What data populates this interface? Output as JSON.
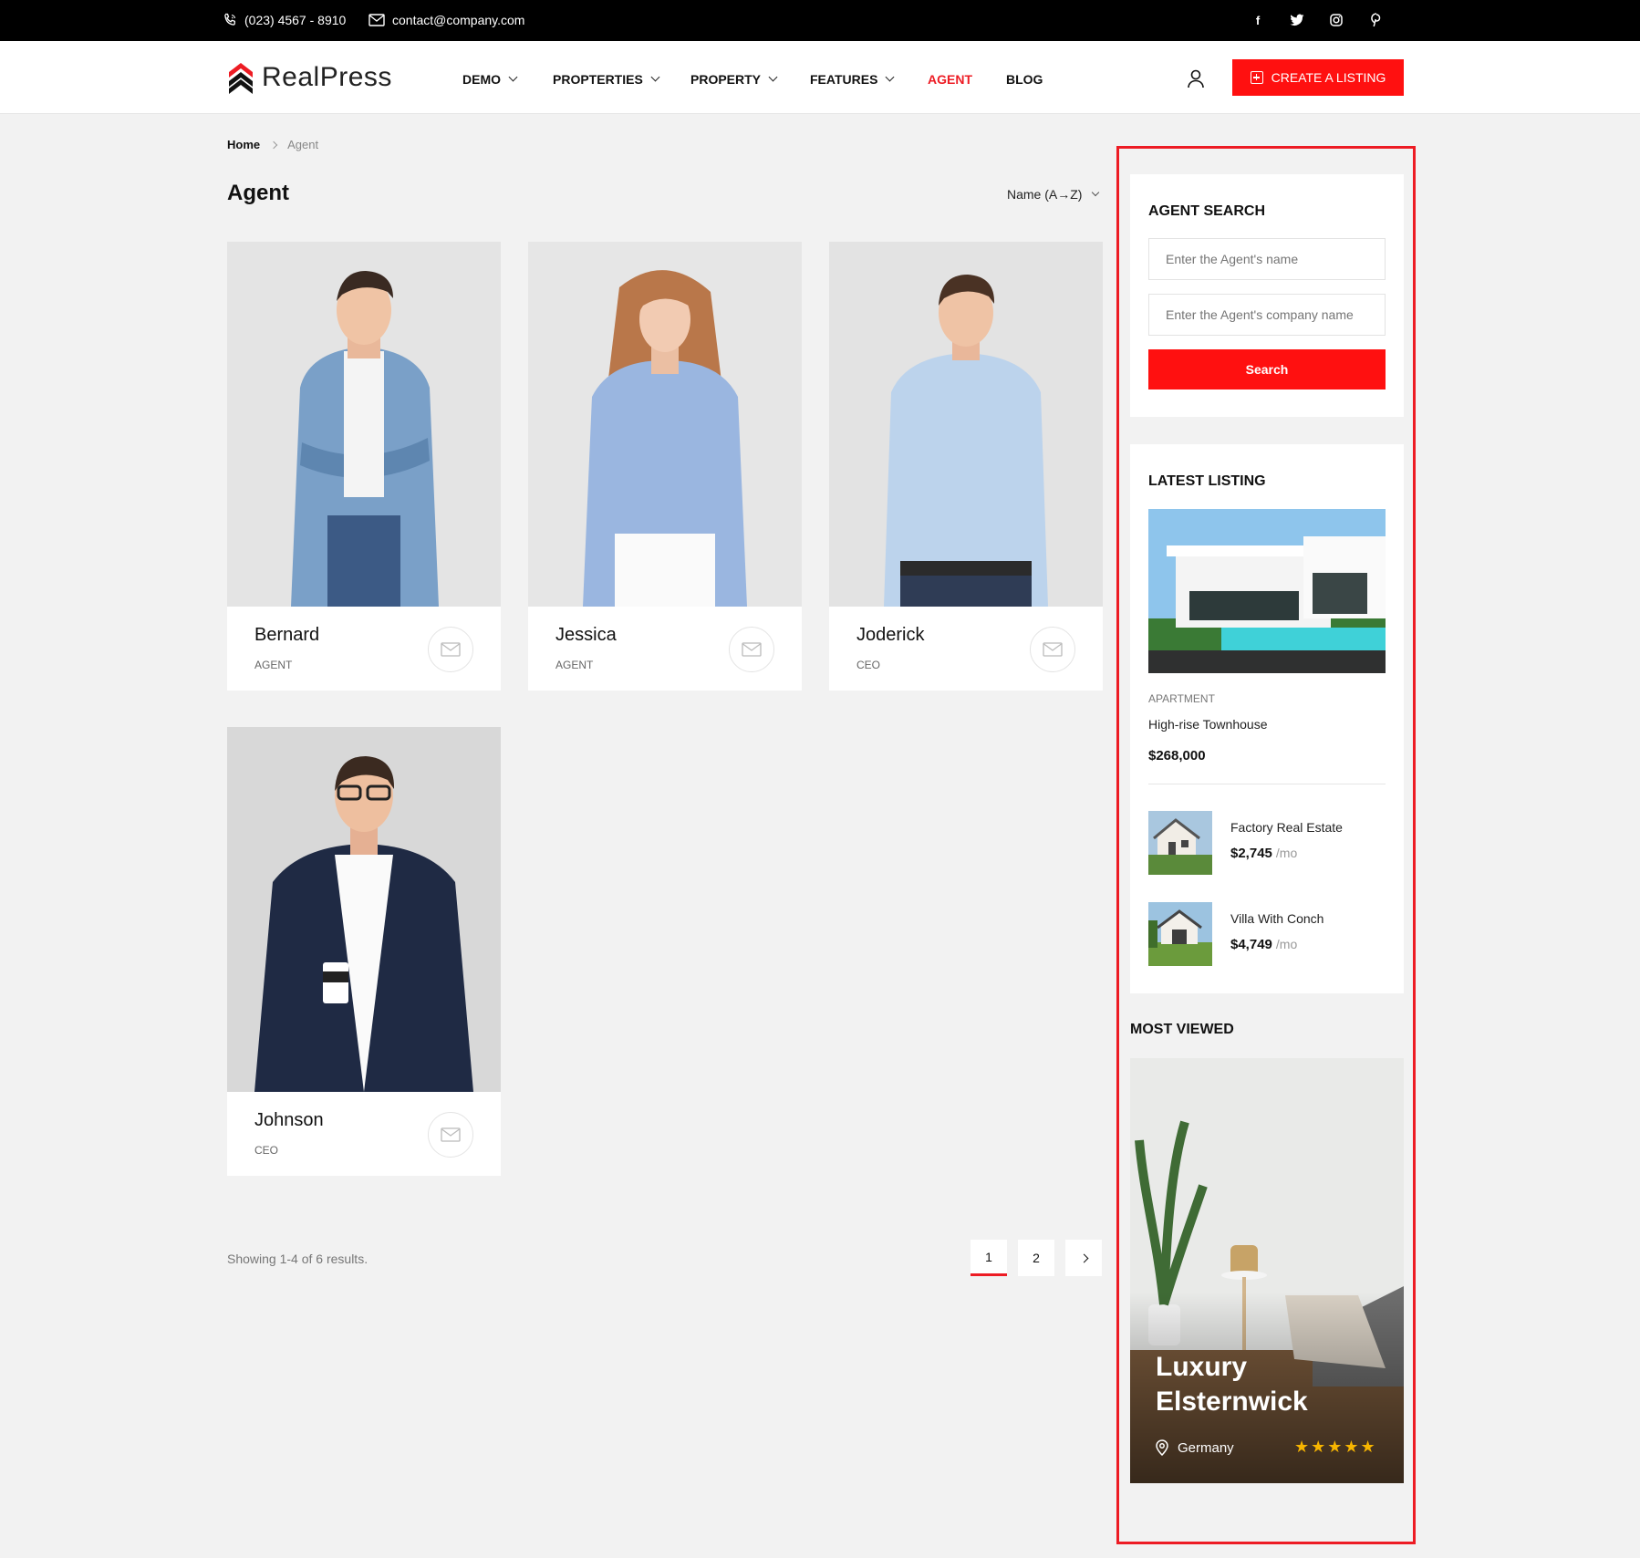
{
  "topbar": {
    "phone": "(023) 4567 - 8910",
    "email": "contact@company.com",
    "social": [
      {
        "icon": "facebook-icon",
        "glyph": "f"
      },
      {
        "icon": "twitter-icon",
        "glyph": "t"
      },
      {
        "icon": "instagram-icon",
        "glyph": "◎"
      },
      {
        "icon": "pinterest-icon",
        "glyph": "p"
      }
    ]
  },
  "header": {
    "logo_text": "RealPress",
    "nav": [
      {
        "label": "DEMO",
        "dropdown": true
      },
      {
        "label": "PROPTERTIES",
        "dropdown": true
      },
      {
        "label": "PROPERTY",
        "dropdown": true
      },
      {
        "label": "FEATURES",
        "dropdown": true
      },
      {
        "label": "AGENT",
        "dropdown": false,
        "active": true
      },
      {
        "label": "BLOG",
        "dropdown": false
      }
    ],
    "create_button": "CREATE A LISTING"
  },
  "breadcrumb": {
    "home": "Home",
    "current": "Agent"
  },
  "page_title": "Agent",
  "sort_label": "Name (A→Z)",
  "agents": [
    {
      "name": "Bernard",
      "role": "AGENT"
    },
    {
      "name": "Jessica",
      "role": "AGENT"
    },
    {
      "name": "Joderick",
      "role": "CEO"
    },
    {
      "name": "Johnson",
      "role": "CEO"
    }
  ],
  "pagination": {
    "showing": "Showing 1-4 of 6 results.",
    "pages": [
      "1",
      "2"
    ],
    "current": "1"
  },
  "sidebar": {
    "agent_search": {
      "title": "AGENT SEARCH",
      "name_placeholder": "Enter the Agent's name",
      "company_placeholder": "Enter the Agent's company name",
      "button": "Search"
    },
    "latest_listing": {
      "title": "LATEST LISTING",
      "featured": {
        "category": "APARTMENT",
        "name": "High-rise Townhouse",
        "price": "$268,000"
      },
      "items": [
        {
          "name": "Factory Real Estate",
          "price": "$2,745",
          "unit": "/mo"
        },
        {
          "name": "Villa With Conch",
          "price": "$4,749",
          "unit": "/mo"
        }
      ]
    },
    "most_viewed": {
      "title": "MOST VIEWED",
      "name": "Luxury Elsternwick",
      "location": "Germany",
      "stars": "★★★★★"
    }
  },
  "colors": {
    "accent": "#ed1c24",
    "topbar": "#000000",
    "page_bg": "#f2f2f2"
  }
}
